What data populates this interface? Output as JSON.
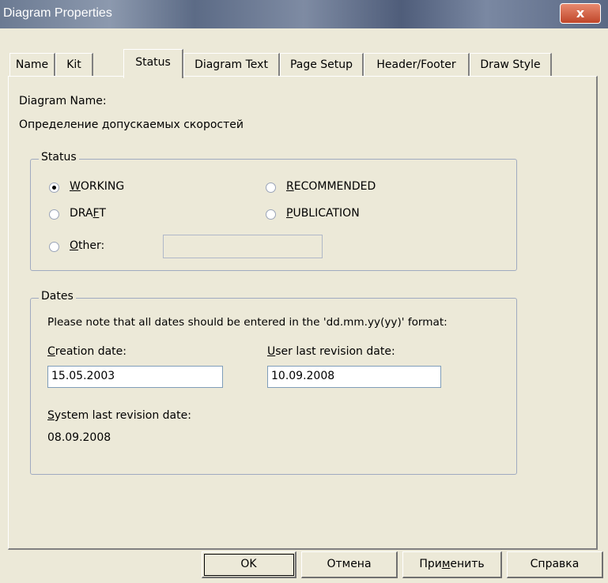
{
  "window": {
    "title": "Diagram Properties",
    "close_glyph": "x"
  },
  "tabs": [
    {
      "label": "Name"
    },
    {
      "label": "Kit"
    },
    {
      "label": "Status"
    },
    {
      "label": "Diagram Text"
    },
    {
      "label": "Page Setup"
    },
    {
      "label": "Header/Footer"
    },
    {
      "label": "Draw Style"
    }
  ],
  "active_tab": "Status",
  "diagram": {
    "name_label": "Diagram Name:",
    "name_value": "Определение допускаемых скоростей"
  },
  "status": {
    "group_label": "Status",
    "options": {
      "working": {
        "pre": "",
        "key": "W",
        "post": "ORKING",
        "selected": true
      },
      "recommended": {
        "pre": "",
        "key": "R",
        "post": "ECOMMENDED",
        "selected": false
      },
      "draft": {
        "pre": "DRA",
        "key": "F",
        "post": "T",
        "selected": false
      },
      "publication": {
        "pre": "",
        "key": "P",
        "post": "UBLICATION",
        "selected": false
      },
      "other": {
        "pre": "",
        "key": "O",
        "post": "ther:",
        "selected": false
      }
    },
    "other_value": ""
  },
  "dates": {
    "group_label": "Dates",
    "note": "Please note that all dates should be entered in the 'dd.mm.yy(yy)' format:",
    "creation_label": {
      "key": "C",
      "rest": "reation date:"
    },
    "creation_value": "15.05.2003",
    "user_revision_label": {
      "key": "U",
      "rest": "ser last revision date:"
    },
    "user_revision_value": "10.09.2008",
    "system_revision_label": {
      "key": "S",
      "rest": "ystem last revision date:"
    },
    "system_revision_value": "08.09.2008"
  },
  "buttons": {
    "ok": {
      "label": "OK"
    },
    "cancel": {
      "label": "Отмена"
    },
    "apply": {
      "pre": "При",
      "key": "м",
      "post": "енить"
    },
    "help": {
      "label": "Справка"
    }
  }
}
